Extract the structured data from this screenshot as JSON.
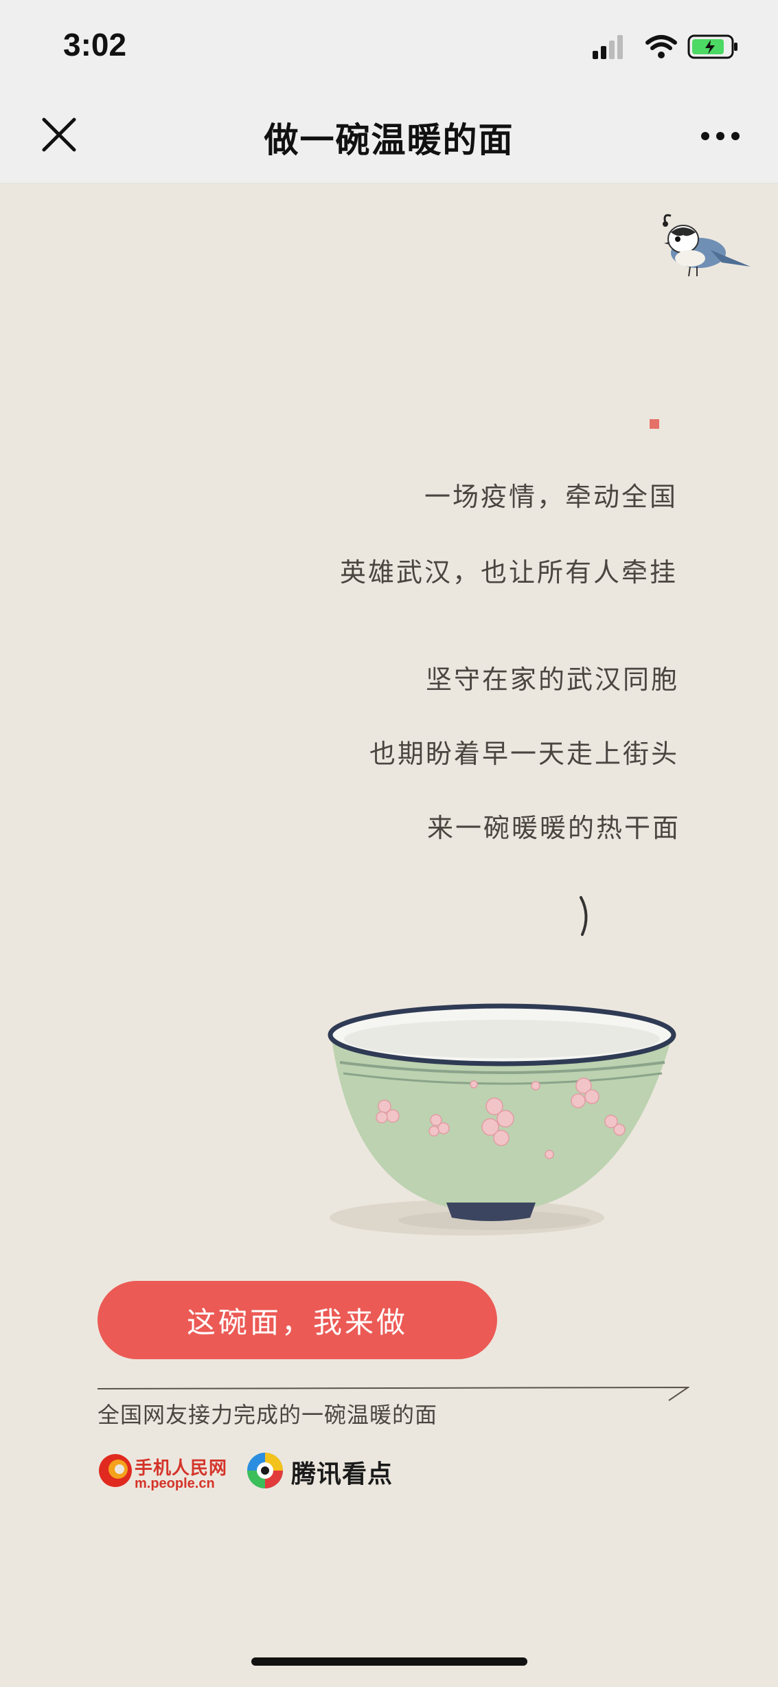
{
  "status": {
    "time": "3:02"
  },
  "nav": {
    "title": "做一碗温暖的面"
  },
  "poem": [
    "一场疫情，牵动全国",
    "英雄武汉，也让所有人牵挂",
    "坚守在家的武汉同胞",
    "也期盼着早一天走上街头",
    "来一碗暖暖的热干面"
  ],
  "cta": {
    "label": "这碗面，我来做"
  },
  "footer": {
    "caption": "全国网友接力完成的一碗温暖的面",
    "people_logo": "手机人民网",
    "people_url": "m.people.cn",
    "tencent_logo": "腾讯看点"
  },
  "colors": {
    "background": "#ece7de",
    "accent": "#ec5a55",
    "text": "#4a4540"
  },
  "icons": [
    "close-icon",
    "more-icon",
    "bird-icon",
    "bowl-illustration",
    "people-logo-icon",
    "tencent-logo-icon"
  ]
}
